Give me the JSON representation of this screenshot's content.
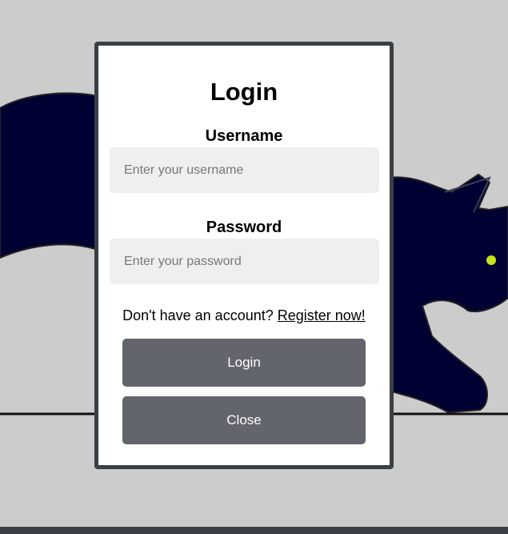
{
  "background": {
    "color": "#cccccc",
    "cat_color": "#000033",
    "cat_eye_color": "#c6e21b"
  },
  "modal": {
    "title": "Login",
    "username": {
      "label": "Username",
      "placeholder": "Enter your username",
      "value": ""
    },
    "password": {
      "label": "Password",
      "placeholder": "Enter your password",
      "value": ""
    },
    "register": {
      "prompt": "Don't have an account?",
      "link_text": "Register now!"
    },
    "login_button": "Login",
    "close_button": "Close"
  },
  "colors": {
    "button": "#62656c",
    "modal_border": "#3a3e45",
    "input_background": "#efefef"
  }
}
